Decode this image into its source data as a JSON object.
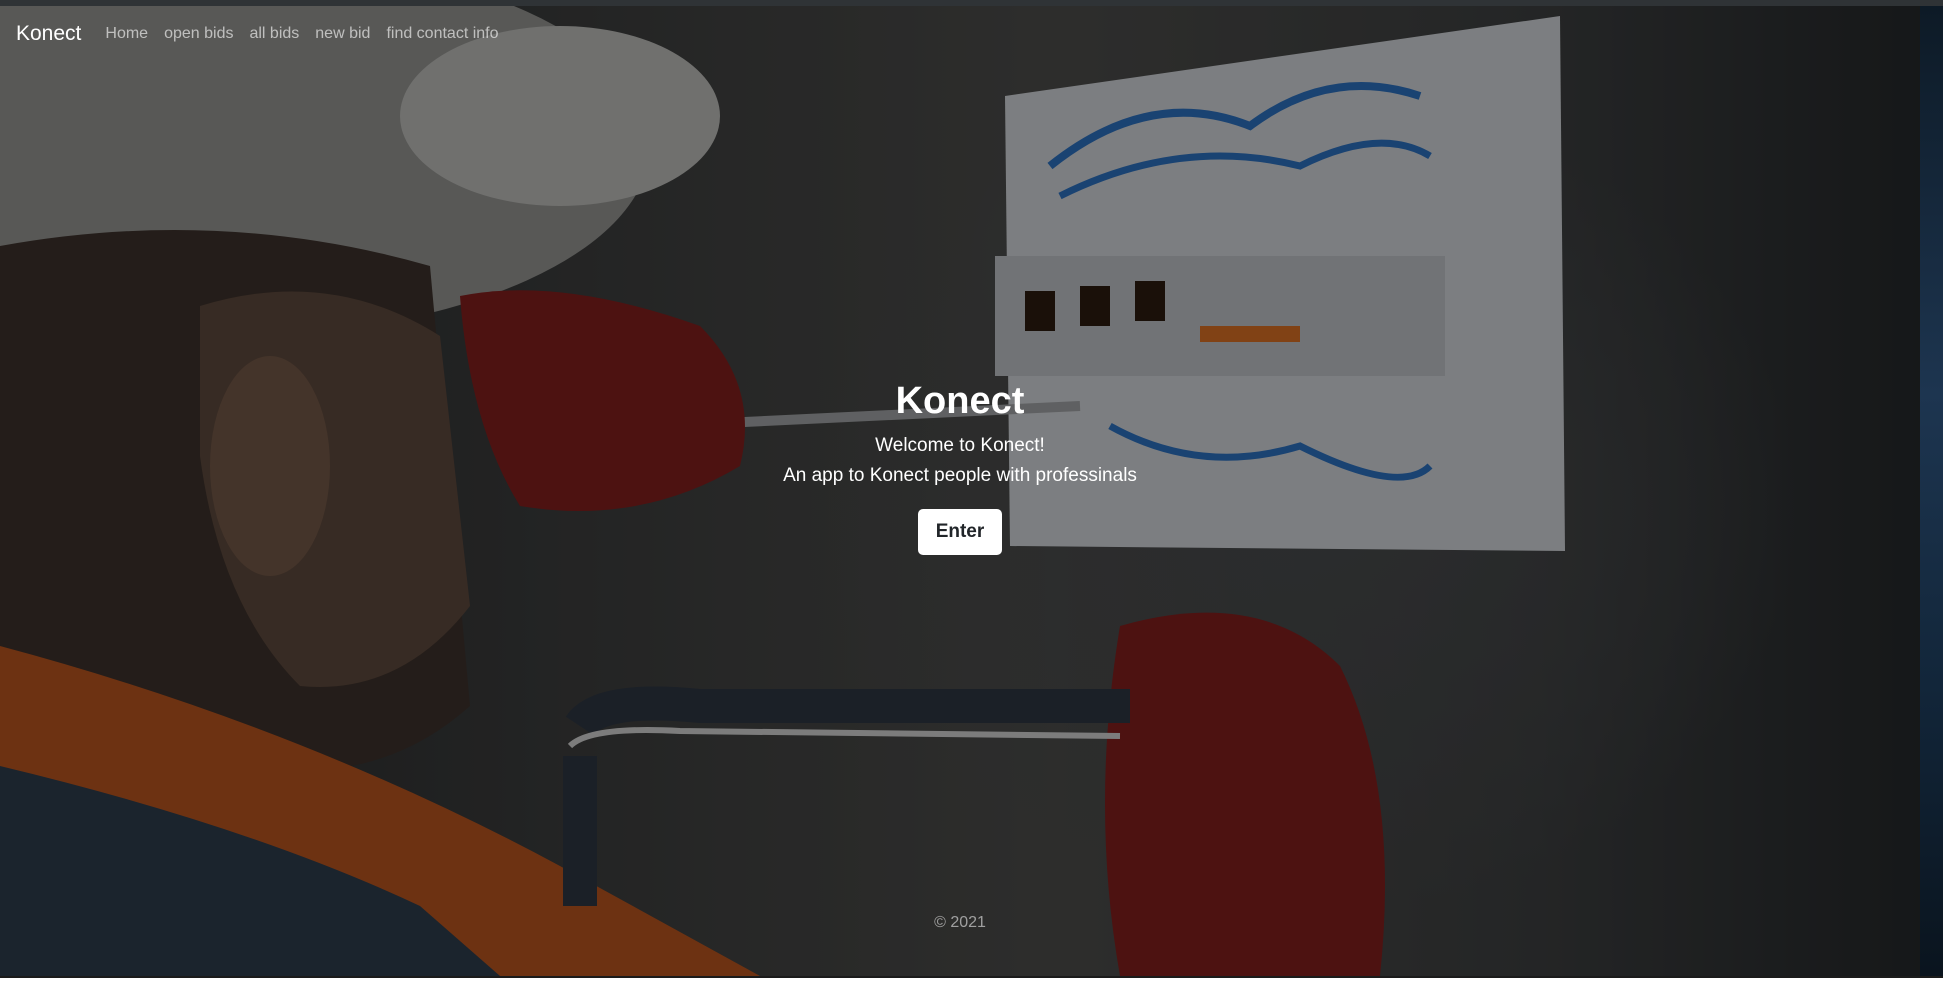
{
  "navbar": {
    "brand": "Konect",
    "links": [
      "Home",
      "open bids",
      "all bids",
      "new bid",
      "find contact info"
    ]
  },
  "hero": {
    "title": "Konect",
    "welcome": "Welcome to Konect!",
    "tagline": "An app to Konect people with professinals",
    "enter_label": "Enter"
  },
  "footer": {
    "copyright": "© 2021"
  },
  "colors": {
    "overlay": "#000000",
    "nav_link": "#a6a6a6",
    "button_bg": "#ffffff",
    "glove": "#7d1e1c",
    "vest": "#c0501a"
  }
}
